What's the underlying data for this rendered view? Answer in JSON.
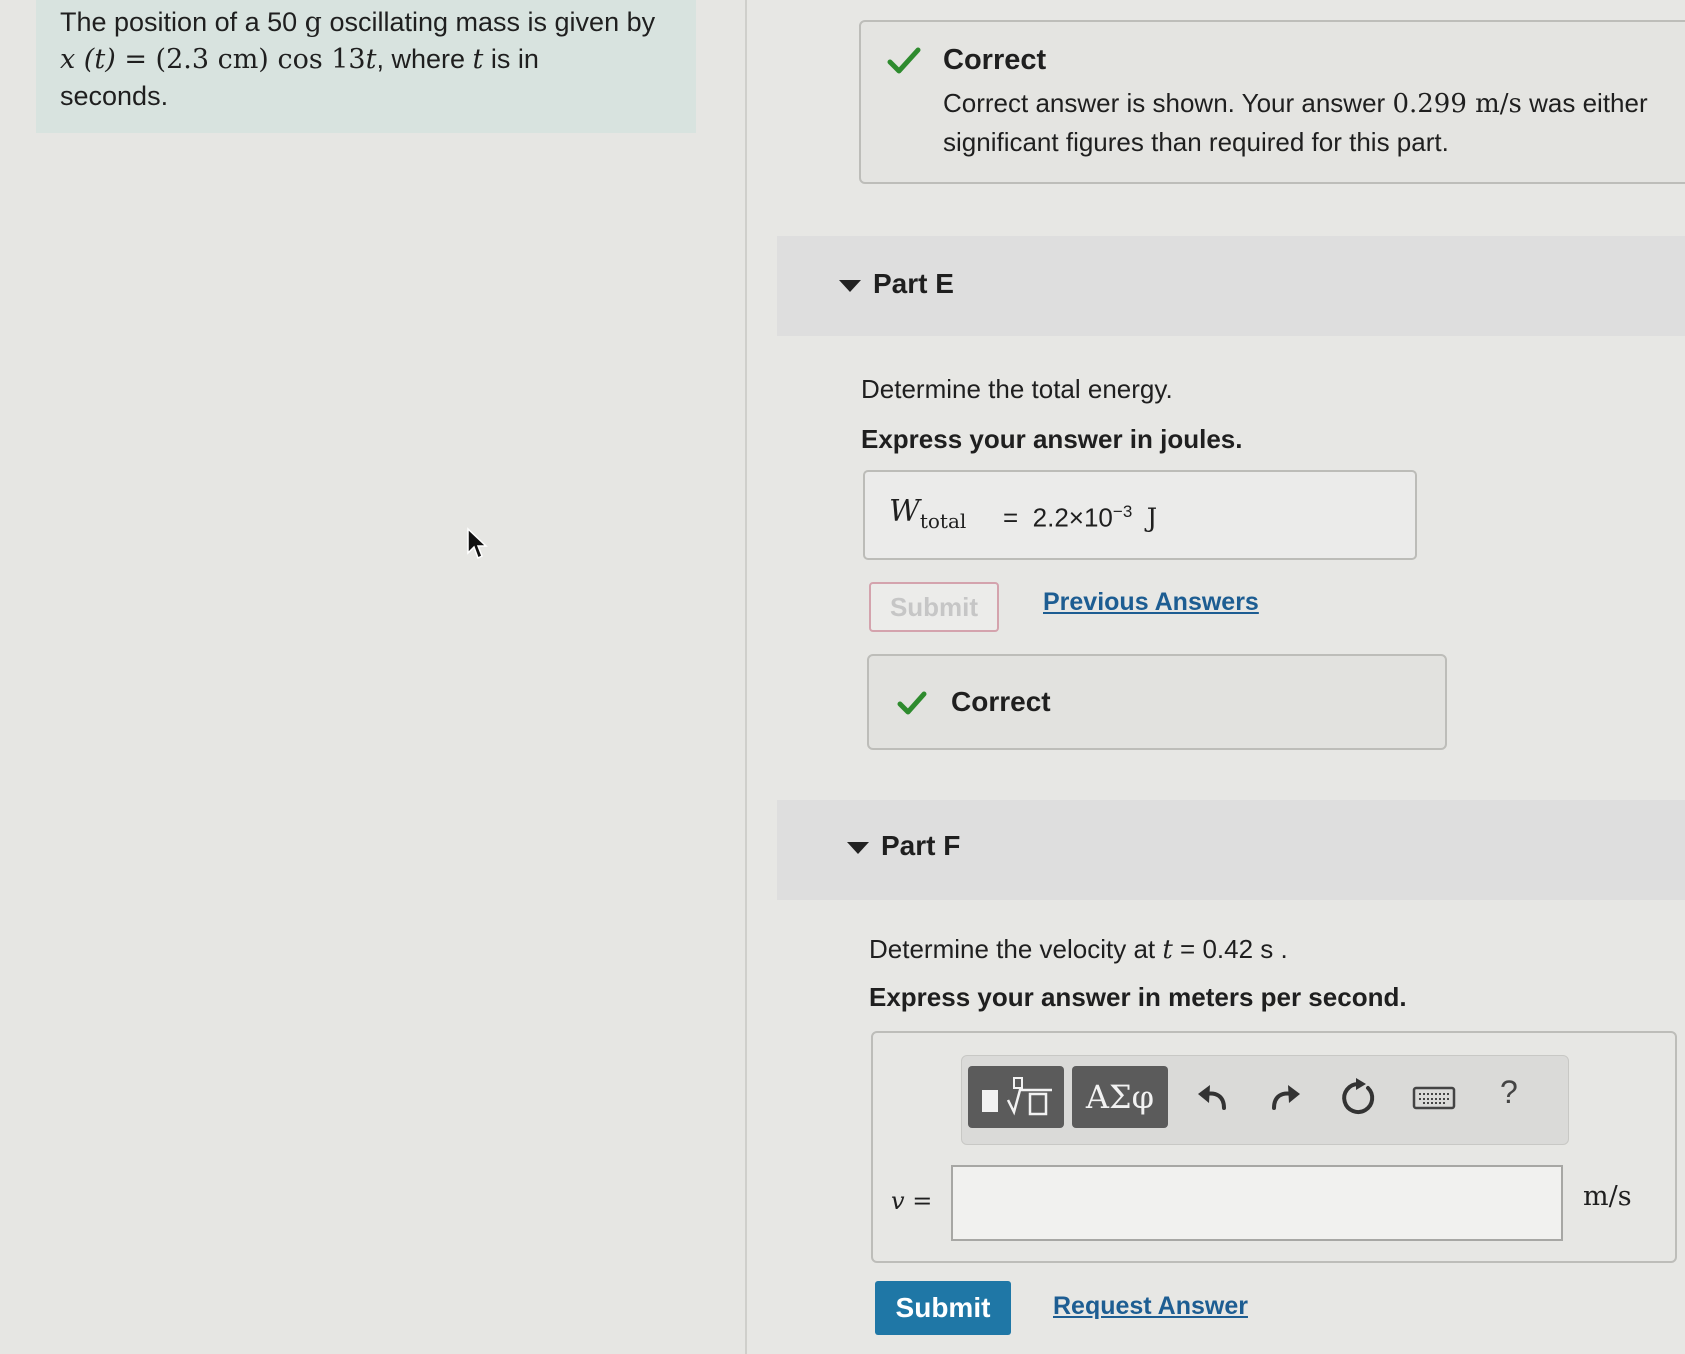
{
  "problem": {
    "line1_prefix": "The position of a 50 ",
    "line1_unit": "g",
    "line1_suffix": " oscillating mass is given by",
    "eq_lhs": "x (t)",
    "eq_eq": " = ",
    "eq_amp": "(2.3 cm)",
    "eq_cos": " cos 13",
    "eq_t": "t",
    "eq_where": ", where ",
    "eq_t2": "t",
    "eq_isin": " is in",
    "line3": "seconds."
  },
  "part_d_feedback": {
    "title": "Correct",
    "text_prefix": "Correct answer is shown. Your answer ",
    "answer_value": "0.299 m/s",
    "text_suffix": " was either",
    "line2": "significant figures than required for this part."
  },
  "part_e": {
    "title": "Part E",
    "question": "Determine the total energy.",
    "instruction": "Express your answer in joules.",
    "answer_lhs_main": "W",
    "answer_lhs_sub": "total",
    "answer_eq": "=",
    "answer_mantissa": "2.2×10",
    "answer_exponent": "−3",
    "answer_unit": "J",
    "submit_label": "Submit",
    "previous_answers_label": "Previous Answers",
    "feedback_title": "Correct"
  },
  "part_f": {
    "title": "Part F",
    "question_prefix": "Determine the velocity at ",
    "question_var": "t",
    "question_suffix": " = 0.42  s .",
    "instruction": "Express your answer in meters per second.",
    "toolbar": {
      "greek_label": "ΑΣφ",
      "help_label": "?"
    },
    "variable_label": "v =",
    "input_value": "",
    "unit_label": "m/s",
    "submit_label": "Submit",
    "request_answer_label": "Request Answer"
  },
  "colors": {
    "problem_bg": "#d8e3df",
    "check_green": "#2e8b2e",
    "submit_blue": "#1f77a6",
    "link_blue": "#1d5d92"
  }
}
